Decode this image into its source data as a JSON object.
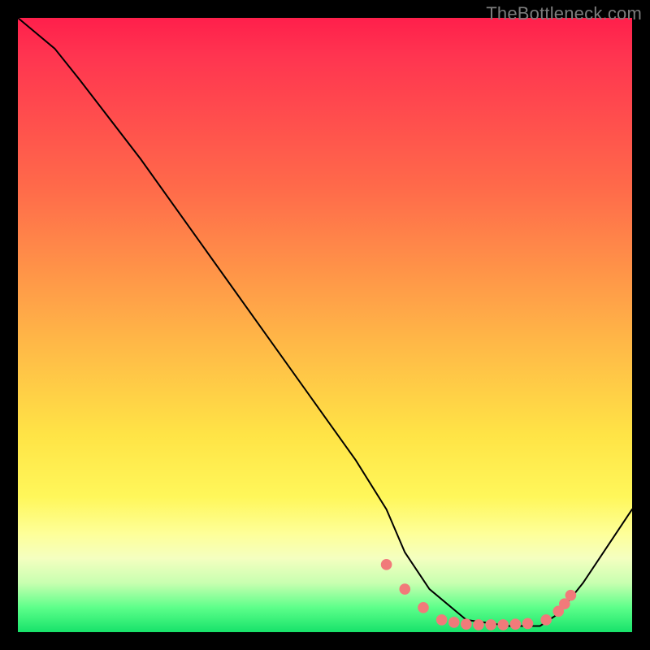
{
  "watermark": "TheBottleneck.com",
  "chart_data": {
    "type": "line",
    "title": "",
    "xlabel": "",
    "ylabel": "",
    "xlim": [
      0,
      100
    ],
    "ylim": [
      0,
      100
    ],
    "series": [
      {
        "name": "curve",
        "x": [
          0,
          6,
          10,
          20,
          30,
          40,
          50,
          55,
          60,
          63,
          67,
          73,
          80,
          85,
          88,
          92,
          96,
          100
        ],
        "y": [
          100,
          95,
          90,
          77,
          63,
          49,
          35,
          28,
          20,
          13,
          7,
          2,
          1,
          1,
          3,
          8,
          14,
          20
        ]
      }
    ],
    "markers": {
      "name": "sweet-spot-dots",
      "color": "#f17a7a",
      "x": [
        60,
        63,
        66,
        69,
        71,
        73,
        75,
        77,
        79,
        81,
        83,
        86,
        88,
        89,
        90
      ],
      "y": [
        11,
        7,
        4,
        2,
        1.6,
        1.3,
        1.2,
        1.2,
        1.2,
        1.3,
        1.4,
        2,
        3.4,
        4.6,
        6
      ]
    },
    "gradient_stops": [
      {
        "pos": 0,
        "color": "#ff1f4b"
      },
      {
        "pos": 28,
        "color": "#ff6b4a"
      },
      {
        "pos": 52,
        "color": "#ffb547"
      },
      {
        "pos": 78,
        "color": "#fff75a"
      },
      {
        "pos": 92,
        "color": "#c8ffb0"
      },
      {
        "pos": 100,
        "color": "#17e26a"
      }
    ]
  }
}
